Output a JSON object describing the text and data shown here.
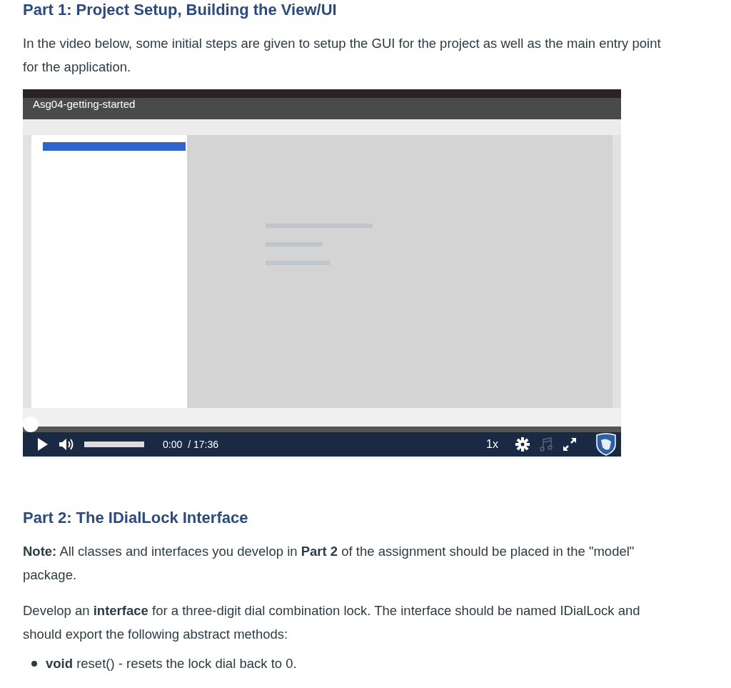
{
  "part1": {
    "heading": "Part 1: Project Setup, Building the View/UI",
    "intro": "In the video below, some initial steps are given to setup the GUI for the project as well as the main entry point for the application."
  },
  "video": {
    "title": "Asg04-getting-started",
    "progress": {
      "level": 0
    },
    "volume": {
      "level": 1
    },
    "time": "0:00",
    "duration": "/ 17:36",
    "speed": "1x",
    "audio_description": {
      "disabled": true
    }
  },
  "part2": {
    "heading": "Part 2: The IDialLock Interface",
    "paragraphs": [
      "**Note:** All classes and interfaces you develop in **Part 2** of the assignment should be placed in the \"model\" package.",
      "Develop an **interface** for a three-digit dial combination lock. The interface should be named IDialLock and should export the following abstract methods:"
    ],
    "bullets": [
      "**void** reset() - resets the lock dial back to 0."
    ]
  }
}
